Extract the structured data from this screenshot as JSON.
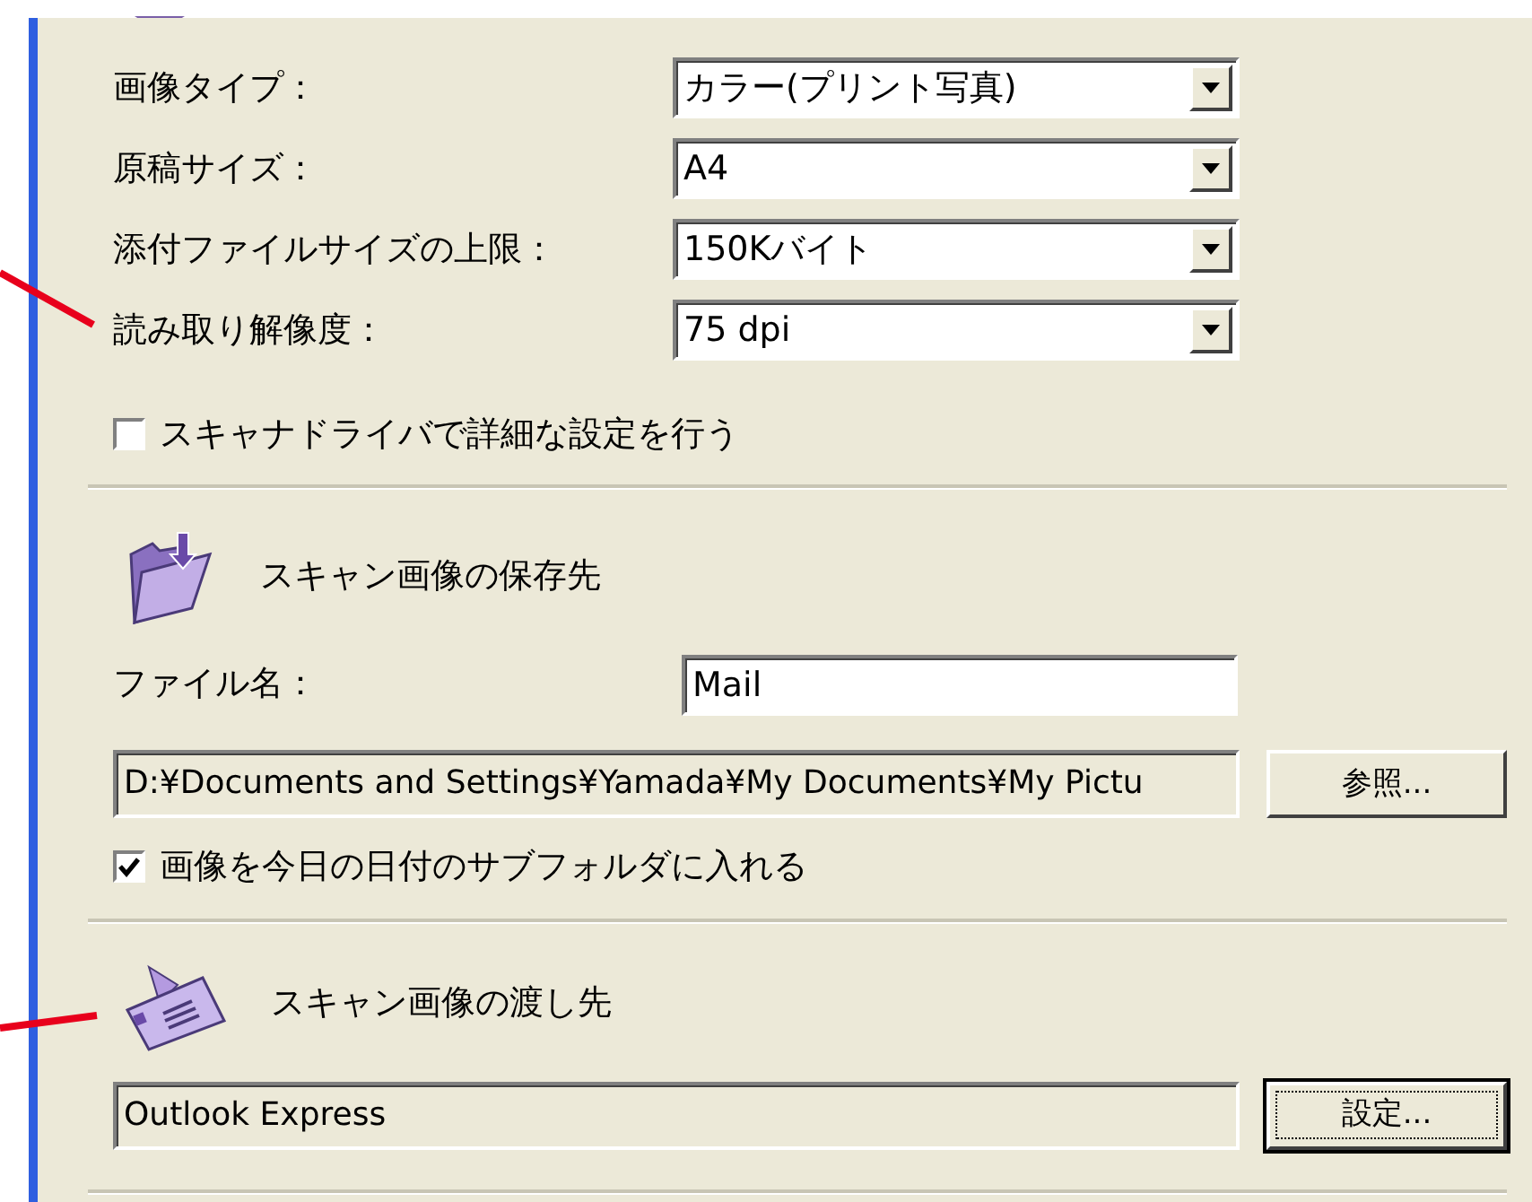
{
  "settings": [
    {
      "label": "画像タイプ：",
      "value": "カラー(プリント写真)"
    },
    {
      "label": "原稿サイズ：",
      "value": "A4"
    },
    {
      "label": "添付ファイルサイズの上限：",
      "value": "150Kバイト"
    },
    {
      "label": "読み取り解像度：",
      "value": "75 dpi"
    }
  ],
  "driver_checkbox": {
    "label": "スキャナドライバで詳細な設定を行う",
    "checked": false
  },
  "save_section": {
    "heading": "スキャン画像の保存先",
    "filename_label": "ファイル名：",
    "filename_value": "Mail",
    "path_value": "D:¥Documents and Settings¥Yamada¥My Documents¥My Pictu",
    "browse_button": "参照...",
    "date_subfolder": {
      "label": "画像を今日の日付のサブフォルダに入れる",
      "checked": true
    }
  },
  "send_section": {
    "heading": "スキャン画像の渡し先",
    "app_value": "Outlook Express",
    "settings_button": "設定...",
    "settings_button_focused": true
  }
}
